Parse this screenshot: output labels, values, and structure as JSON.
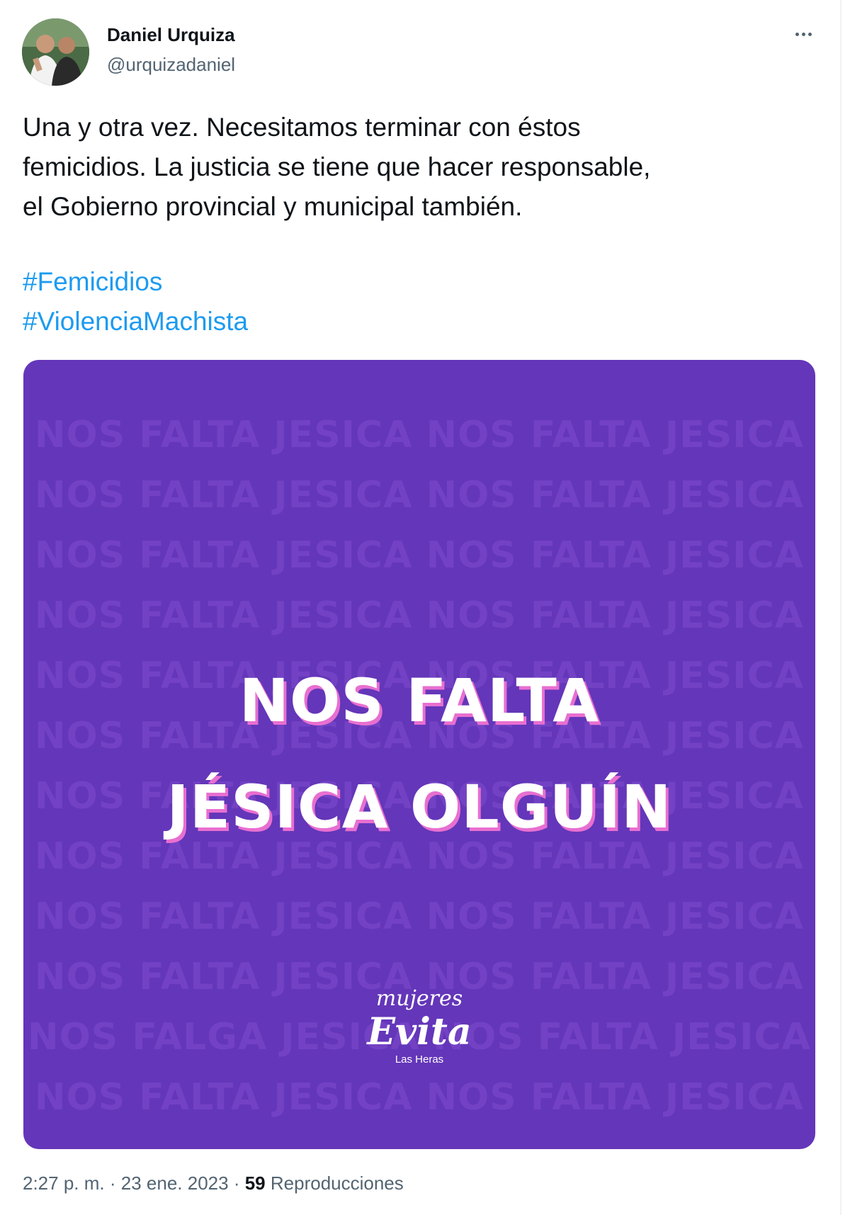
{
  "author": {
    "display_name": "Daniel Urquiza",
    "handle": "@urquizadaniel",
    "avatar_icon": "profile-photo"
  },
  "more_icon": "more-horizontal-icon",
  "tweet": {
    "text_lines": [
      "Una y otra vez. Necesitamos terminar con éstos",
      "femicidios. La justicia se tiene que hacer responsable,",
      "el Gobierno provincial y municipal también."
    ],
    "hashtags": [
      "#Femicidios",
      "#ViolenciaMachista"
    ]
  },
  "media": {
    "background_color": "#6436b9",
    "pattern_rows": [
      "NOS FALTA JESICA NOS FALTA JESICA",
      "NOS FALTA JESICA NOS FALTA JESICA",
      "NOS FALTA JESICA NOS FALTA JESICA",
      "NOS FALTA JESICA NOS FALTA JESICA",
      "NOS FALTA JESICA NOS FALTA JESICA",
      "NOS FALTA JESICA NOS FALTA JESICA",
      "NOS FALTA JESICA NOS FALTA JESICA",
      "NOS FALTA JESICA NOS FALTA JESICA",
      "NOS FALTA JESICA NOS FALTA JESICA",
      "NOS FALTA JESICA NOS FALTA JESICA",
      "NOS FALGA JESICA NOS FALTA JESICA",
      "NOS FALTA JESICA NOS FALTA JESICA"
    ],
    "headline_line1": "NOS FALTA",
    "headline_line2": "JÉSICA OLGUÍN",
    "logo_word1": "mujeres",
    "logo_word2": "Evita",
    "logo_sub": "Las Heras"
  },
  "footer": {
    "time": "2:27 p. m.",
    "separator": "·",
    "date": "23 ene. 2023",
    "views_count": "59",
    "views_label": "Reproducciones"
  },
  "colors": {
    "link": "#1d9bf0",
    "secondary_text": "#536471",
    "headline_shadow": "#e86fd0"
  }
}
